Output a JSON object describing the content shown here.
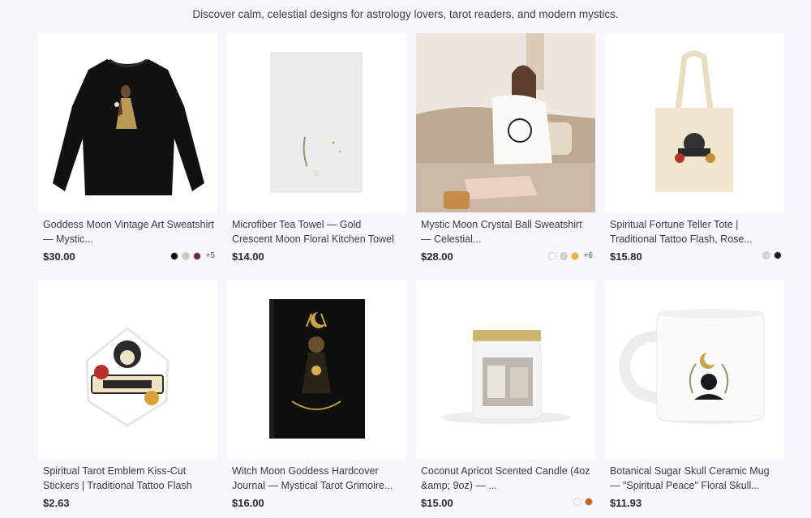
{
  "tagline": "Discover calm, celestial designs for astrology lovers, tarot readers, and modern mystics.",
  "products": [
    {
      "title": "Goddess Moon Vintage Art Sweatshirt — Mystic...",
      "price": "$30.00",
      "swatches": [
        "#000000",
        "#d3c9b6",
        "#6b2d3c"
      ],
      "more": "+5",
      "image_icon": "black-sweatshirt-goddess-print"
    },
    {
      "title": "Microfiber Tea Towel — Gold Crescent Moon Floral Kitchen Towel",
      "price": "$14.00",
      "swatches": [],
      "more": "",
      "image_icon": "tea-towel-crescent-moon"
    },
    {
      "title": "Mystic Moon Crystal Ball Sweatshirt — Celestial...",
      "price": "$28.00",
      "swatches": [
        "#ffffff",
        "#d9d3c2",
        "#f2b326"
      ],
      "more": "+6",
      "image_icon": "model-wearing-white-sweatshirt"
    },
    {
      "title": "Spiritual Fortune Teller Tote | Traditional Tattoo Flash, Rose...",
      "price": "$15.80",
      "swatches": [
        "#dcd3c4",
        "#1e1e1e"
      ],
      "more": "",
      "image_icon": "canvas-tote-bag"
    },
    {
      "title": "Spiritual Tarot Emblem Kiss-Cut Stickers | Traditional Tattoo Flash",
      "price": "$2.63",
      "swatches": [],
      "more": "",
      "image_icon": "spiritual-emblem-sticker"
    },
    {
      "title": "Witch Moon Goddess Hardcover Journal — Mystical Tarot Grimoire...",
      "price": "$16.00",
      "swatches": [],
      "more": "",
      "image_icon": "black-hardcover-journal"
    },
    {
      "title": "Coconut Apricot Scented Candle (4oz &amp; 9oz) — ...",
      "price": "$15.00",
      "swatches": [
        "#ffffff",
        "#c8611c"
      ],
      "more": "",
      "image_icon": "glass-jar-candle"
    },
    {
      "title": "Botanical Sugar Skull Ceramic Mug — \"Spiritual Peace\" Floral Skull...",
      "price": "$11.93",
      "swatches": [],
      "more": "",
      "image_icon": "white-ceramic-mug"
    }
  ]
}
